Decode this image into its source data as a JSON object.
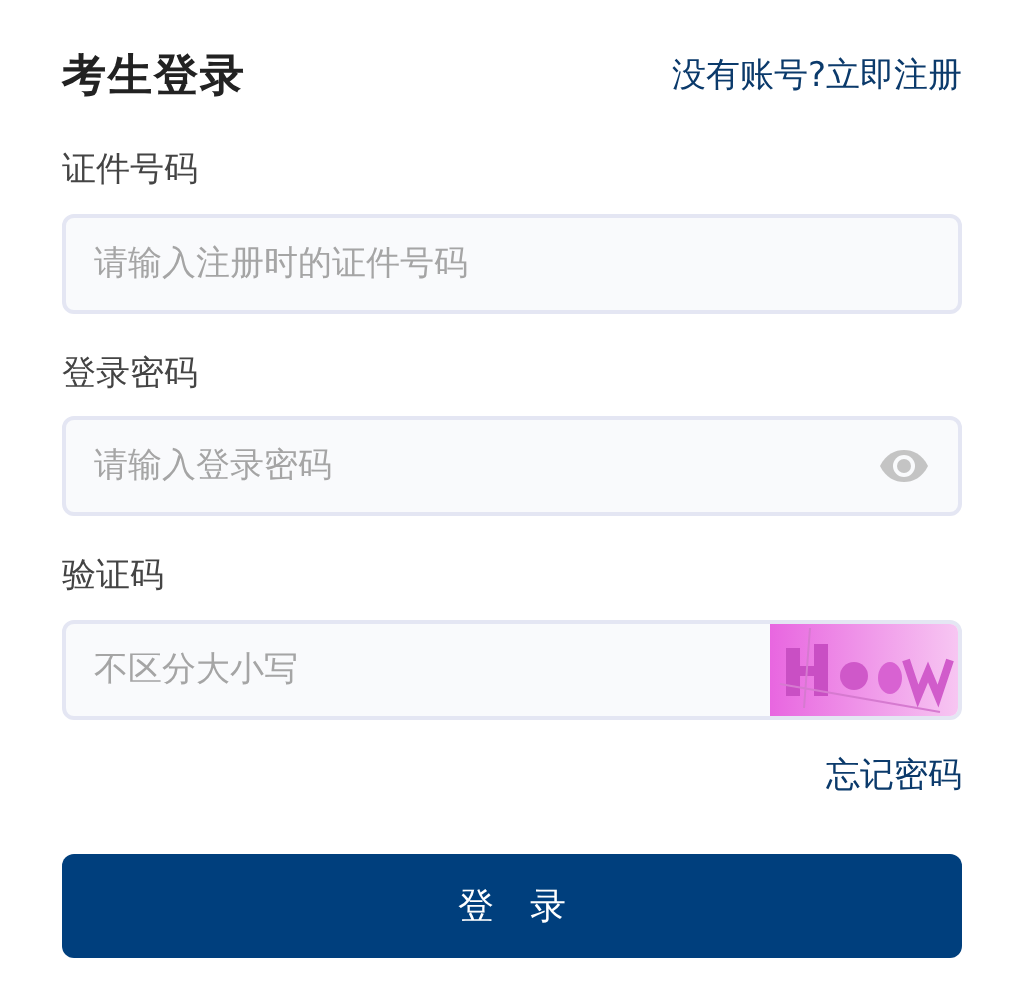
{
  "title": "考生登录",
  "register_link": "没有账号?立即注册",
  "fields": [
    {
      "label": "证件号码",
      "placeholder": "请输入注册时的证件号码",
      "kind": "text"
    },
    {
      "label": "登录密码",
      "placeholder": "请输入登录密码",
      "kind": "password"
    },
    {
      "label": "验证码",
      "placeholder": "不区分大小写",
      "kind": "captcha"
    }
  ],
  "forgot_link": "忘记密码",
  "login_button": "登　录"
}
